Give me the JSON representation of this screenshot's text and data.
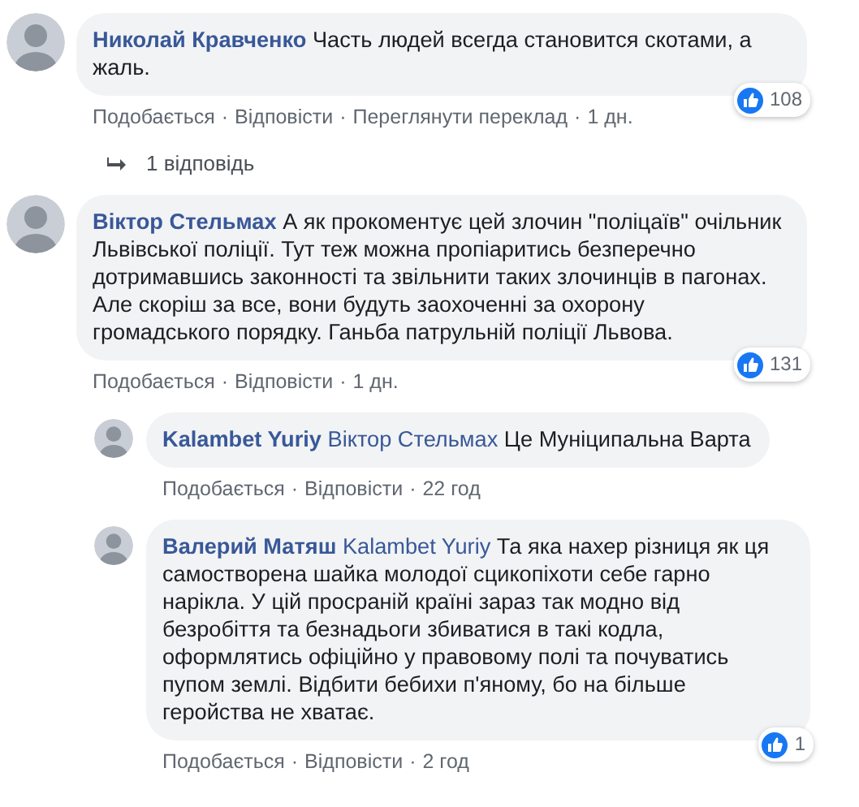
{
  "comments": [
    {
      "author": "Николай Кравченко",
      "text": "Часть людей всегда становится скотами, а жаль.",
      "reactions": "108",
      "actions": [
        {
          "kind": "link",
          "text": "Подобається"
        },
        {
          "kind": "separator",
          "text": "·"
        },
        {
          "kind": "link",
          "text": "Відповісти"
        },
        {
          "kind": "separator",
          "text": "·"
        },
        {
          "kind": "link",
          "text": "Переглянути переклад"
        },
        {
          "kind": "separator",
          "text": "·"
        },
        {
          "kind": "time",
          "text": "1 дн."
        }
      ],
      "replies_link": "1 відповідь"
    },
    {
      "author": "Віктор Стельмах",
      "text": "А як прокоментує цей злочин \"поліцаїв\" очільник Львівської поліції. Тут теж можна пропіаритись безперечно дотримавшись законності та звільнити таких злочинців в пагонах.\nАле скоріш за все, вони будуть заохоченні за охорону громадського порядку. Ганьба патрульній поліції Львова.",
      "reactions": "131",
      "actions": [
        {
          "kind": "link",
          "text": "Подобається"
        },
        {
          "kind": "separator",
          "text": "·"
        },
        {
          "kind": "link",
          "text": "Відповісти"
        },
        {
          "kind": "separator",
          "text": "·"
        },
        {
          "kind": "time",
          "text": "1 дн."
        }
      ],
      "replies": [
        {
          "author": "Kalambet Yuriy",
          "mention": "Віктор Стельмах",
          "text": "Це Муніципальна Варта",
          "actions": [
            {
              "kind": "link",
              "text": "Подобається"
            },
            {
              "kind": "separator",
              "text": "·"
            },
            {
              "kind": "link",
              "text": "Відповісти"
            },
            {
              "kind": "separator",
              "text": "·"
            },
            {
              "kind": "time",
              "text": "22 год"
            }
          ]
        },
        {
          "author": "Валерий Матяш",
          "mention": "Kalambet Yuriy",
          "text": "Та яка нахер різниця як ця самостворена шайка молодої сцикопіхоти себе гарно нарікла. У цій просраній країні зараз так модно від безробіття та безнадьоги збиватися в такі кодла, оформлятись офіційно у правовому полі та почуватись пупом землі. Відбити бебихи п'яному, бо на більше геройства не хватає.",
          "reactions": "1",
          "actions": [
            {
              "kind": "link",
              "text": "Подобається"
            },
            {
              "kind": "separator",
              "text": "·"
            },
            {
              "kind": "link",
              "text": "Відповісти"
            },
            {
              "kind": "separator",
              "text": "·"
            },
            {
              "kind": "time",
              "text": "2 год"
            }
          ]
        }
      ]
    }
  ]
}
